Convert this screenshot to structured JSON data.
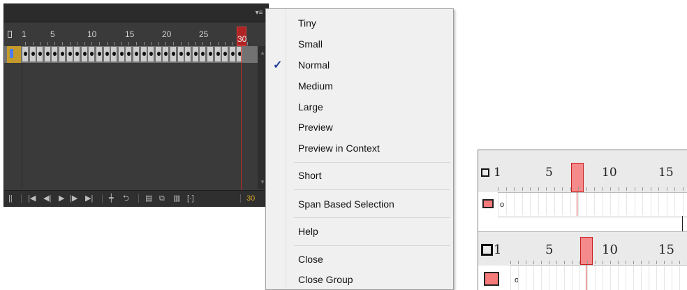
{
  "timeline": {
    "menu_icon": "panel-menu-icon",
    "ruler_labels": [
      "1",
      "5",
      "10",
      "15",
      "20",
      "25",
      "30"
    ],
    "current_frame": "30",
    "toolbar_icons": [
      "layer-handle-icon",
      "first-frame-icon",
      "prev-frame-icon",
      "play-icon",
      "next-frame-icon",
      "last-frame-icon",
      "center-frame-icon",
      "loop-icon",
      "onion-skin-icon",
      "onion-outline-icon",
      "edit-multiple-frames-icon",
      "onion-markers-icon"
    ]
  },
  "menu": {
    "items": [
      {
        "label": "Tiny"
      },
      {
        "label": "Small"
      },
      {
        "label": "Normal",
        "checked": true
      },
      {
        "label": "Medium"
      },
      {
        "label": "Large"
      },
      {
        "label": "Preview"
      },
      {
        "label": "Preview in Context"
      },
      {
        "label": "Short"
      },
      {
        "label": "Span Based Selection"
      },
      {
        "label": "Help"
      },
      {
        "label": "Close"
      },
      {
        "label": "Close Group"
      }
    ],
    "check_glyph": "✓"
  },
  "preview": {
    "small_labels": [
      "1",
      "5",
      "10",
      "15"
    ],
    "large_labels": [
      "1",
      "5",
      "10",
      "15"
    ],
    "frame_marker": "o"
  },
  "colors": {
    "panel_bg": "#3a3a3a",
    "playhead": "#b02424",
    "accent_frame": "#c49a2a",
    "preview_playhead": "#f58a8a"
  }
}
